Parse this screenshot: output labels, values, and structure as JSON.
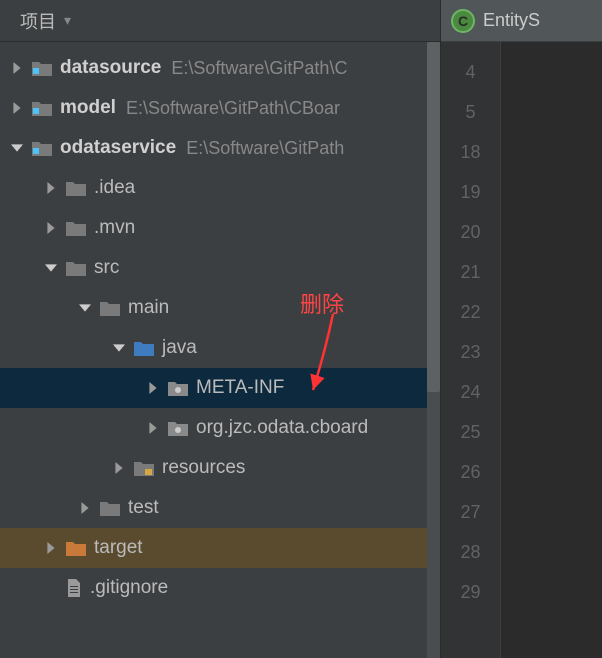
{
  "header": {
    "title": "项目",
    "dropdown_glyph": "▾"
  },
  "tree": {
    "datasource": {
      "name": "datasource",
      "path": "E:\\Software\\GitPath\\C"
    },
    "model": {
      "name": "model",
      "path": "E:\\Software\\GitPath\\CBoar"
    },
    "odataservice": {
      "name": "odataservice",
      "path": "E:\\Software\\GitPath"
    },
    "idea": ".idea",
    "mvn": ".mvn",
    "src": "src",
    "main": "main",
    "java": "java",
    "metainf": "META-INF",
    "package": "org.jzc.odata.cboard",
    "resources": "resources",
    "test": "test",
    "target": "target",
    "gitignore": ".gitignore"
  },
  "annotation": "删除",
  "editor": {
    "tab_label": "EntityS",
    "class_letter": "C",
    "line_numbers": [
      "4",
      "5",
      "18",
      "19",
      "20",
      "21",
      "22",
      "23",
      "24",
      "25",
      "26",
      "27",
      "28",
      "29"
    ]
  }
}
